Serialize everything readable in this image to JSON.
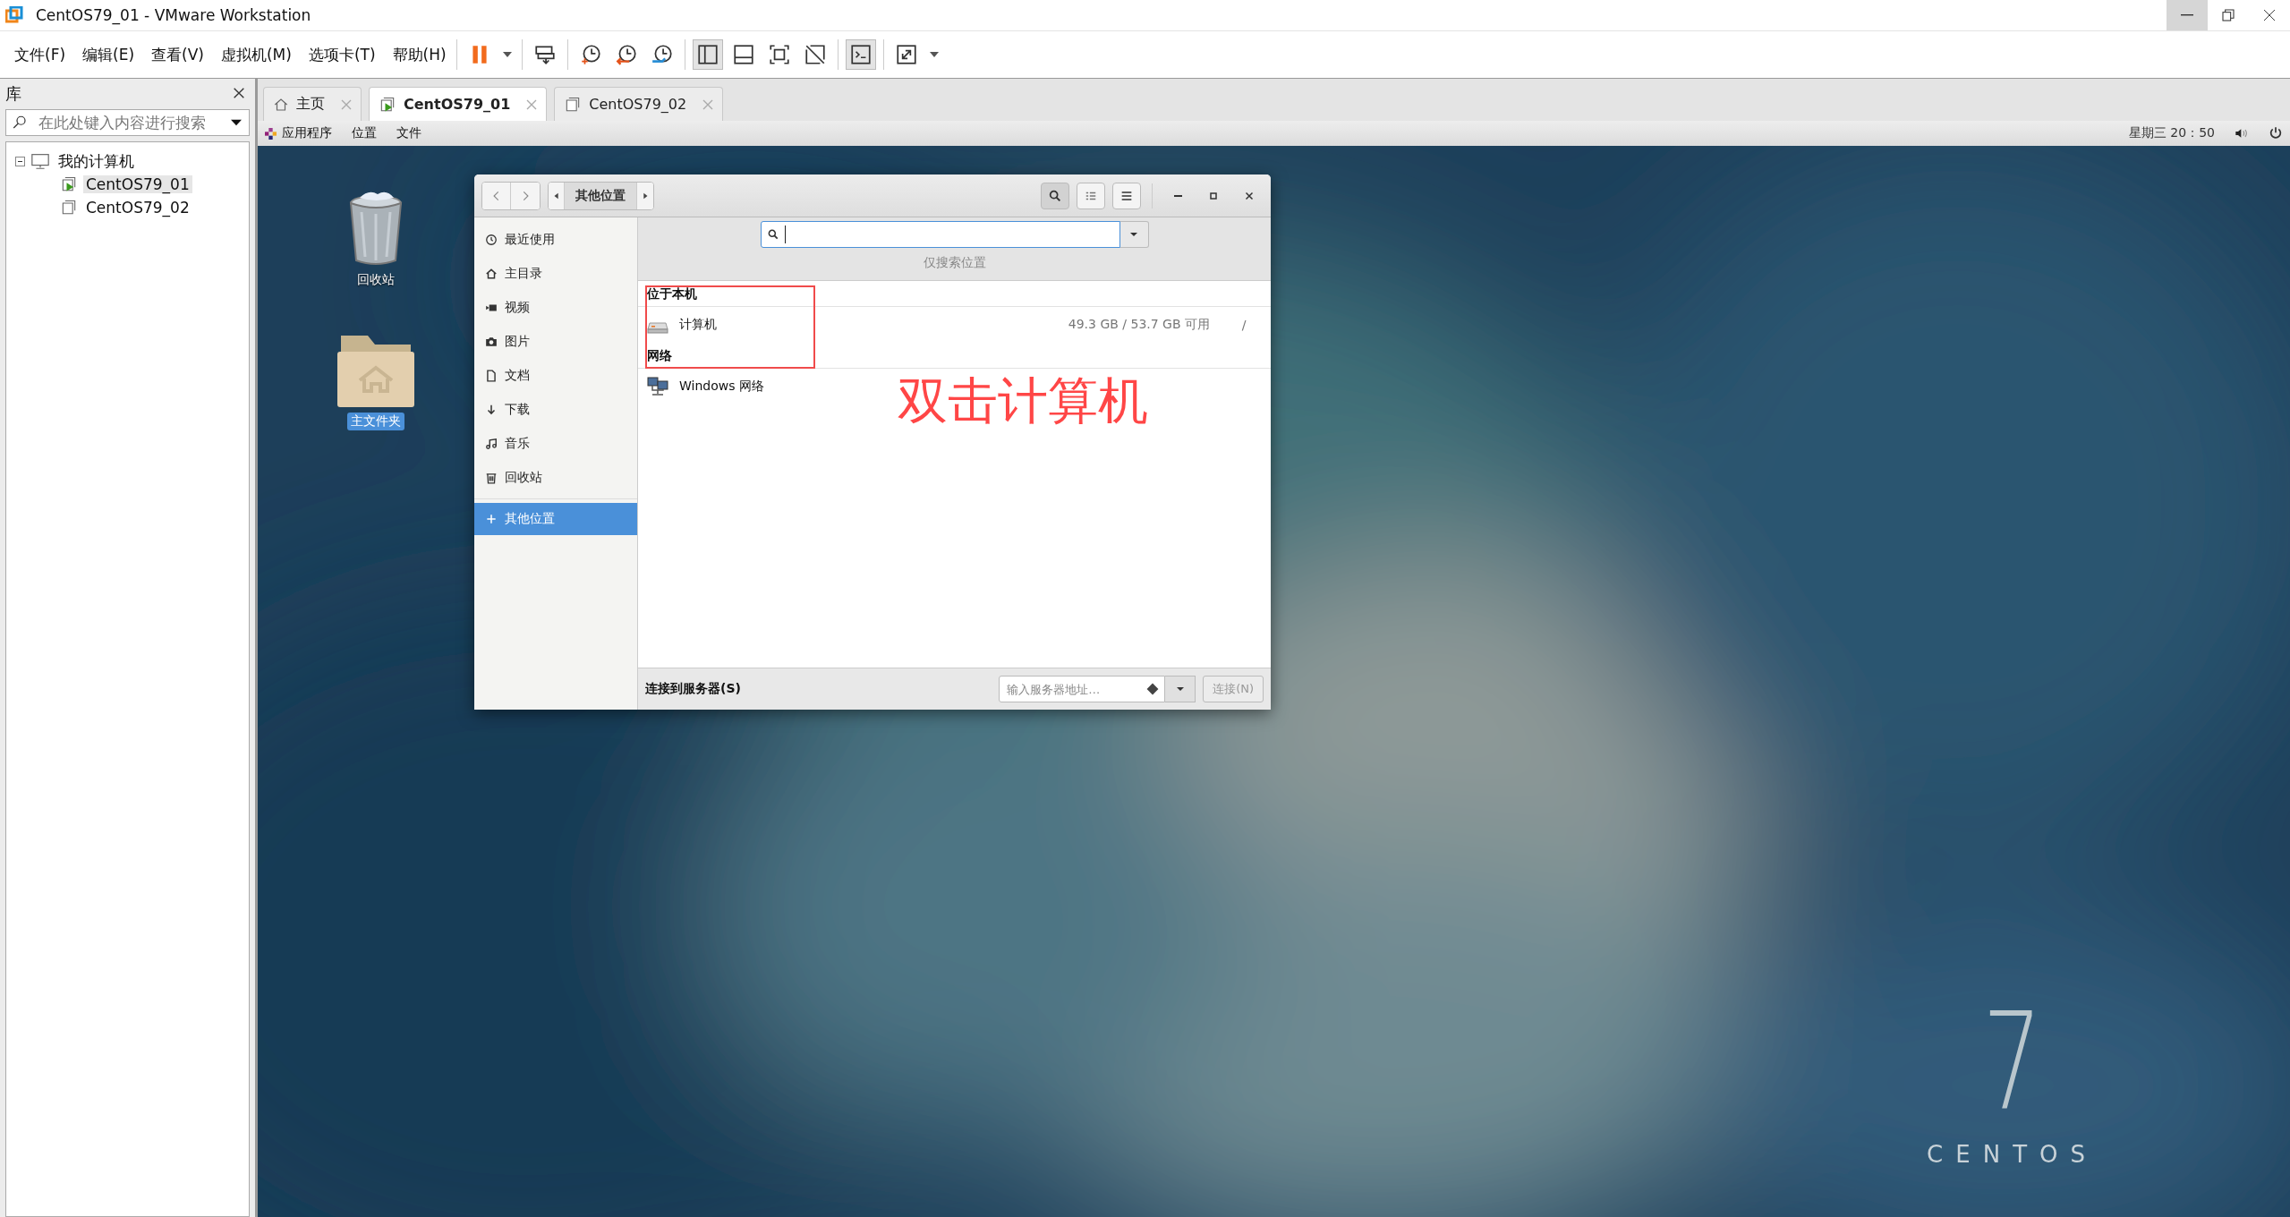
{
  "window": {
    "title": "CentOS79_01 - VMware Workstation"
  },
  "menu": [
    "文件(F)",
    "编辑(E)",
    "查看(V)",
    "虚拟机(M)",
    "选项卡(T)",
    "帮助(H)"
  ],
  "toolbar": [
    [
      {
        "kind": "pause",
        "selected": false
      },
      {
        "kind": "caret",
        "selected": false
      }
    ],
    [
      {
        "kind": "send-keys",
        "selected": false
      }
    ],
    [
      {
        "kind": "snapshot-take",
        "selected": false
      },
      {
        "kind": "snapshot-revert",
        "selected": false
      },
      {
        "kind": "snapshot-manager",
        "selected": false
      }
    ],
    [
      {
        "kind": "view-library",
        "selected": true
      },
      {
        "kind": "view-thumbnail",
        "selected": false
      },
      {
        "kind": "view-fullscreen",
        "selected": false
      },
      {
        "kind": "view-unity",
        "selected": false
      }
    ],
    [
      {
        "kind": "console",
        "selected": true
      }
    ],
    [
      {
        "kind": "stretch",
        "selected": false
      },
      {
        "kind": "caret",
        "selected": false
      }
    ]
  ],
  "library": {
    "title": "库",
    "search": {
      "placeholder": "在此处键入内容进行搜索"
    },
    "tree": [
      {
        "label": "我的计算机",
        "expanded": true,
        "selected": false,
        "children": [
          {
            "label": "CentOS79_01",
            "running": true,
            "selected": true
          },
          {
            "label": "CentOS79_02",
            "running": false,
            "selected": false
          }
        ]
      }
    ]
  },
  "tabs": [
    {
      "label": "主页",
      "kind": "home",
      "selected": false
    },
    {
      "label": "CentOS79_01",
      "kind": "vm",
      "running": true,
      "selected": true
    },
    {
      "label": "CentOS79_02",
      "kind": "vm",
      "running": false,
      "selected": false
    }
  ],
  "guest_topbar": {
    "menus": [
      "应用程序",
      "位置",
      "文件"
    ],
    "clock": "星期三 20：50"
  },
  "desktop": {
    "icons": [
      {
        "label": "回收站",
        "kind": "trash",
        "selected": false
      },
      {
        "label": "主文件夹",
        "kind": "home-folder",
        "selected": true
      }
    ],
    "logo": {
      "numeral": "7",
      "name": "CENTOS"
    }
  },
  "file_manager": {
    "path": "其他位置",
    "search_hint": "仅搜索位置",
    "sidebar": [
      {
        "label": "最近使用",
        "kind": "recent",
        "selected": false
      },
      {
        "label": "主目录",
        "kind": "home",
        "selected": false
      },
      {
        "label": "视频",
        "kind": "video",
        "selected": false
      },
      {
        "label": "图片",
        "kind": "camera",
        "selected": false
      },
      {
        "label": "文档",
        "kind": "document",
        "selected": false
      },
      {
        "label": "下载",
        "kind": "download",
        "selected": false
      },
      {
        "label": "音乐",
        "kind": "music",
        "selected": false
      },
      {
        "label": "回收站",
        "kind": "trash",
        "selected": false
      },
      {
        "label": "其他位置",
        "kind": "plus",
        "selected": true
      }
    ],
    "sections": [
      {
        "title": "位于本机",
        "items": [
          {
            "name": "计算机",
            "kind": "drive",
            "usage": "49.3 GB / 53.7 GB 可用",
            "mount": "/"
          }
        ]
      },
      {
        "title": "网络",
        "items": [
          {
            "name": "Windows 网络",
            "kind": "network"
          }
        ]
      }
    ],
    "connect": {
      "label": "连接到服务器(S)",
      "placeholder": "输入服务器地址…",
      "button": "连接(N)",
      "button_disabled": true
    }
  },
  "annotation": {
    "text": "双击计算机"
  }
}
